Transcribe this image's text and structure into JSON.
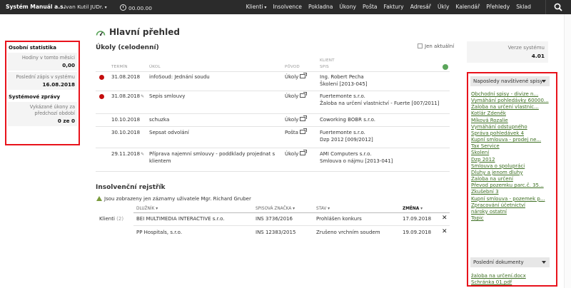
{
  "topbar": {
    "brand": "Systém Manuál a.s.",
    "user": "Ivan Kutil JUDr.",
    "timer": "00.00.00",
    "nav": [
      "Klienti",
      "Insolvence",
      "Pokladna",
      "Úkony",
      "Pošta",
      "Faktury",
      "Adresář",
      "Úkly",
      "Kalendář",
      "Přehledy",
      "Sklad"
    ]
  },
  "left_panel": {
    "section_stats": "Osobní statistika",
    "hours_label": "Hodiny v tomto měsíci",
    "hours_value": "0,00",
    "last_label": "Poslední zápis v systému",
    "last_value": "16.08.2018",
    "section_messages": "Systémové zprávy",
    "reported_label": "Vykázané úkony za předchozí období",
    "reported_value": "0 ze 0"
  },
  "main": {
    "title": "Hlavní přehled",
    "tasks_title": "Úkoly (celodenní)",
    "only_current": "Jen aktuální",
    "headers": {
      "term": "Termín",
      "task": "Úkol",
      "origin": "Původ",
      "client": "Klient",
      "file": "Spis"
    },
    "tasks": [
      {
        "flag": true,
        "date": "31.08.2018",
        "edited": false,
        "task": [
          "infoSoud: Jednání soudu"
        ],
        "origin": "Úkoly",
        "client": "Ing. Robert Pecha",
        "file": "Školení [2013-045]"
      },
      {
        "flag": true,
        "date": "31.08.2018",
        "edited": true,
        "task": [
          "Sepis smlouvy"
        ],
        "origin": "Úkoly",
        "client": "Fuertemonte s.r.o.",
        "file": "Žaloba na určení vlastnictví - Fuerte [007/2011]"
      },
      {
        "flag": false,
        "date": "10.10.2018",
        "edited": false,
        "task": [
          "schuzka"
        ],
        "origin": "Úkoly",
        "client": "Coworking BOBR s.r.o.",
        "file": ""
      },
      {
        "flag": false,
        "date": "30.10.2018",
        "edited": false,
        "task": [
          "Sepsat odvolání"
        ],
        "origin": "Pošta",
        "client": "Fuertemonte s.r.o.",
        "file": "Dzp 2012 [009/2012]"
      },
      {
        "flag": false,
        "date": "29.11.2018",
        "edited": true,
        "task": [
          "Příprava najemní smlouvy - poddklady projednat s",
          "klientem"
        ],
        "origin": "Úkoly",
        "client": "AMI Computers s.r.o.",
        "file": "Smlouva o nájmu [2013-041]"
      }
    ]
  },
  "insolvency": {
    "title": "Insolvenční rejstřík",
    "note": "Jsou zobrazeny jen záznamy uživatele Mgr. Richard Gruber",
    "headers": {
      "debtor": "Dlužník",
      "file": "Spisová značka",
      "state": "Stav",
      "change": "Změna"
    },
    "group_label": "Klienti",
    "group_count": "(2)",
    "rows": [
      {
        "debtor": "BEI MULTIMEDIA INTERACTIVE s.r.o.",
        "file": "INS 3736/2016",
        "state": "Prohlášen konkurs",
        "change": "17.09.2018"
      },
      {
        "debtor": "PP Hospitals, s.r.o.",
        "file": "INS 12383/2015",
        "state": "Zrušeno vrchním soudem",
        "change": "19.09.2018"
      }
    ]
  },
  "version": {
    "label": "Verze systému",
    "value": "4.01"
  },
  "recent_files": {
    "title": "Naposledy navštívené spisy",
    "items": [
      "Obchodní spisy - divize n...",
      "Vymáhání pohledávky 60000...",
      "Žaloba na určení vlastnic...",
      "Kotlár Zdeněk",
      "Míková Rozalie",
      "Vymáhání odstupného",
      "Správa pohledávek 4",
      "Kupní smlouva - prodej ne...",
      "Tax Service",
      "Školení",
      "Dzp 2012",
      "Smlouva o spolupráci",
      "Dluhy a jenom dluhy",
      "Žaloba na určení",
      "Převod pozemku parc.č. 35...",
      "Zkušební 3",
      "Kupní smlouva - pozemek p...",
      "Zpracování účetnictví",
      "nároky ostatní",
      "Topic"
    ]
  },
  "recent_docs": {
    "title": "Poslední dokumenty",
    "items": [
      "žaloba na určení.docx",
      "Schránka 01.pdf"
    ]
  }
}
